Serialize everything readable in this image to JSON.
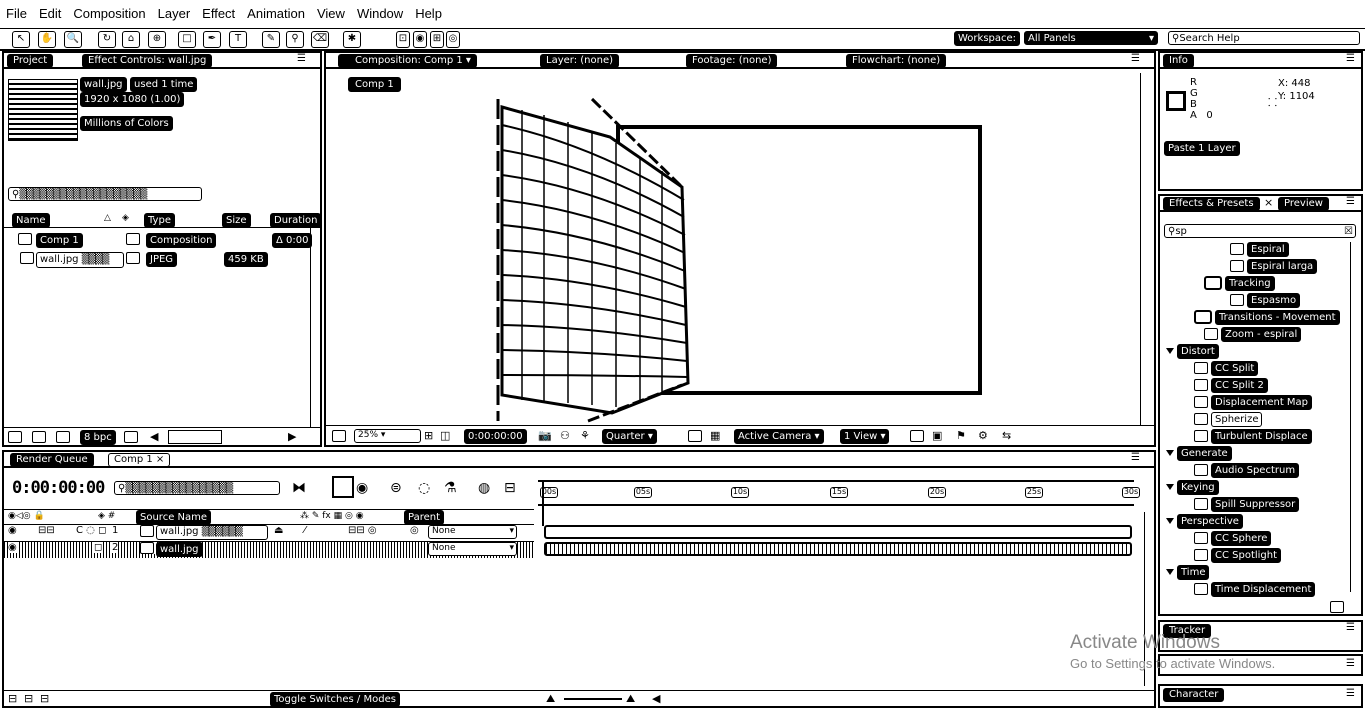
{
  "menu": [
    "File",
    "Edit",
    "Composition",
    "Layer",
    "Effect",
    "Animation",
    "View",
    "Window",
    "Help"
  ],
  "toolbar": {
    "workspace_label": "Workspace:",
    "workspace_value": "All Panels",
    "search_help_placeholder": "Search Help"
  },
  "project_panel": {
    "tabs": [
      "Project",
      "Effect Controls: wall.jpg"
    ],
    "asset_name": "wall.jpg",
    "asset_used": "used 1 time",
    "asset_dims": "1920 x 1080 (1.00)",
    "asset_colors": "Millions of Colors",
    "columns": [
      "Name",
      "Type",
      "Size",
      "Duration"
    ],
    "items": [
      {
        "name": "Comp 1",
        "type": "Composition",
        "size": "",
        "duration": "Δ 0:00"
      },
      {
        "name": "wall.jpg",
        "type": "JPEG",
        "size": "459 KB",
        "duration": ""
      }
    ],
    "bpc": "8 bpc"
  },
  "viewer": {
    "tabs": [
      "Composition: Comp 1",
      "Layer: (none)",
      "Footage: (none)",
      "Flowchart: (none)"
    ],
    "comp_button": "Comp 1",
    "zoom": "25%",
    "timecode": "0:00:00:00",
    "resolution": "Quarter",
    "camera": "Active Camera",
    "views": "1 View"
  },
  "info_panel": {
    "tab": "Info",
    "channels": [
      "R",
      "G",
      "B",
      "A"
    ],
    "alpha_value": "0",
    "x_value": "X: 448",
    "y_value": "Y: 1104",
    "paste_label": "Paste 1 Layer"
  },
  "effects_panel": {
    "tabs": [
      "Effects & Presets",
      "Preview"
    ],
    "search_value": "sp",
    "items": [
      {
        "label": "Espiral",
        "level": 3,
        "kind": "preset"
      },
      {
        "label": "Espiral larga",
        "level": 3,
        "kind": "preset"
      },
      {
        "label": "Tracking",
        "level": 2,
        "kind": "folder"
      },
      {
        "label": "Espasmo",
        "level": 3,
        "kind": "preset"
      },
      {
        "label": "Transitions - Movement",
        "level": 1,
        "kind": "folder"
      },
      {
        "label": "Zoom - espiral",
        "level": 2,
        "kind": "preset"
      },
      {
        "label": "Distort",
        "level": 0,
        "kind": "category"
      },
      {
        "label": "CC Split",
        "level": 1,
        "kind": "effect"
      },
      {
        "label": "CC Split 2",
        "level": 1,
        "kind": "effect"
      },
      {
        "label": "Displacement Map",
        "level": 1,
        "kind": "effect"
      },
      {
        "label": "Spherize",
        "level": 1,
        "kind": "effect-selected"
      },
      {
        "label": "Turbulent Displace",
        "level": 1,
        "kind": "effect"
      },
      {
        "label": "Generate",
        "level": 0,
        "kind": "category"
      },
      {
        "label": "Audio Spectrum",
        "level": 1,
        "kind": "effect"
      },
      {
        "label": "Keying",
        "level": 0,
        "kind": "category"
      },
      {
        "label": "Spill Suppressor",
        "level": 1,
        "kind": "effect"
      },
      {
        "label": "Perspective",
        "level": 0,
        "kind": "category"
      },
      {
        "label": "CC Sphere",
        "level": 1,
        "kind": "effect"
      },
      {
        "label": "CC Spotlight",
        "level": 1,
        "kind": "effect"
      },
      {
        "label": "Time",
        "level": 0,
        "kind": "category"
      },
      {
        "label": "Time Displacement",
        "level": 1,
        "kind": "effect"
      }
    ],
    "tracker_tab": "Tracker",
    "character_tab": "Character"
  },
  "timeline": {
    "tabs": [
      "Render Queue",
      "Comp 1"
    ],
    "timecode": "0:00:00:00",
    "columns": {
      "source": "Source Name",
      "parent": "Parent"
    },
    "layers": [
      {
        "num": "1",
        "name": "wall.jpg",
        "parent": "None"
      },
      {
        "num": "2",
        "name": "wall.jpg",
        "parent": "None"
      }
    ],
    "ruler": [
      "00s",
      "05s",
      "10s",
      "15s",
      "20s",
      "25s",
      "30s"
    ],
    "toggle_label": "Toggle Switches / Modes"
  },
  "watermark": {
    "line1": "Activate Windows",
    "line2": "Go to Settings to activate Windows."
  }
}
